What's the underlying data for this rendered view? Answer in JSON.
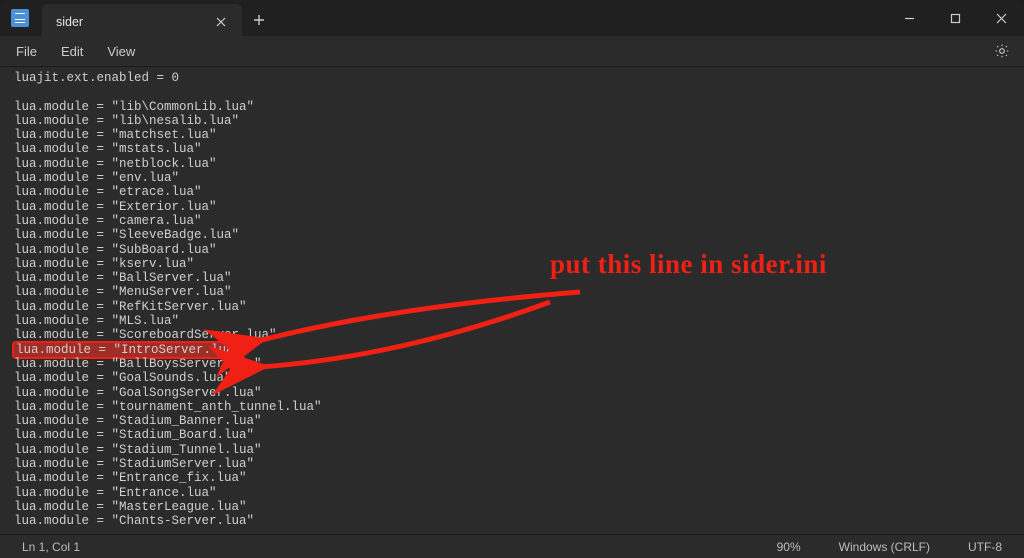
{
  "title": "sider",
  "menubar": {
    "file": "File",
    "edit": "Edit",
    "view": "View"
  },
  "annotation_text": "put this line in sider.ini",
  "editor_lines": [
    "luajit.ext.enabled = 0",
    "",
    "lua.module = \"lib\\CommonLib.lua\"",
    "lua.module = \"lib\\nesalib.lua\"",
    "lua.module = \"matchset.lua\"",
    "lua.module = \"mstats.lua\"",
    "lua.module = \"netblock.lua\"",
    "lua.module = \"env.lua\"",
    "lua.module = \"etrace.lua\"",
    "lua.module = \"Exterior.lua\"",
    "lua.module = \"camera.lua\"",
    "lua.module = \"SleeveBadge.lua\"",
    "lua.module = \"SubBoard.lua\"",
    "lua.module = \"kserv.lua\"",
    "lua.module = \"BallServer.lua\"",
    "lua.module = \"MenuServer.lua\"",
    "lua.module = \"RefKitServer.lua\"",
    "lua.module = \"MLS.lua\"",
    "lua.module = \"ScoreboardServer.lua\"",
    "lua.module = \"IntroServer.lua\"",
    "lua.module = \"BallBoysServer.lua\"",
    "lua.module = \"GoalSounds.lua\"",
    "lua.module = \"GoalSongServer.lua\"",
    "lua.module = \"tournament_anth_tunnel.lua\"",
    "lua.module = \"Stadium_Banner.lua\"",
    "lua.module = \"Stadium_Board.lua\"",
    "lua.module = \"Stadium_Tunnel.lua\"",
    "lua.module = \"StadiumServer.lua\"",
    "lua.module = \"Entrance_fix.lua\"",
    "lua.module = \"Entrance.lua\"",
    "lua.module = \"MasterLeague.lua\"",
    "lua.module = \"Chants-Server.lua\""
  ],
  "highlighted_line_index": 19,
  "statusbar": {
    "position": "Ln 1, Col 1",
    "zoom": "90%",
    "line_ending": "Windows (CRLF)",
    "encoding": "UTF-8"
  }
}
